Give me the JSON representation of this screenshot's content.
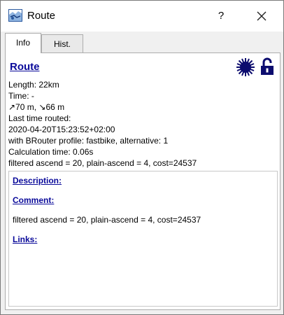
{
  "window": {
    "title": "Route",
    "help_label": "?"
  },
  "tabs": [
    {
      "label": "Info",
      "active": true
    },
    {
      "label": "Hist.",
      "active": false
    }
  ],
  "route": {
    "title": "Route",
    "length": "Length: 22km",
    "time": "Time: -",
    "elevation": "↗70 m, ↘66 m",
    "last_routed_label": "Last time routed:",
    "last_routed_value": "2020-04-20T15:23:52+02:00",
    "profile": "with BRouter profile: fastbike, alternative: 1",
    "calc_time": "Calculation time: 0.06s",
    "stats": "filtered ascend = 20, plain-ascend = 4, cost=24537"
  },
  "details": {
    "description_label": "Description:",
    "comment_label": "Comment:",
    "comment_text": "filtered ascend = 20, plain-ascend = 4, cost=24537",
    "links_label": "Links:"
  },
  "icons": {
    "app": "map-icon",
    "sun": "sun-icon",
    "lock": "unlocked-padlock-icon",
    "close": "close-icon"
  },
  "colors": {
    "link": "#0a0a9a",
    "titlebar": "#ffffff",
    "window_bg": "#f0f0f0"
  }
}
